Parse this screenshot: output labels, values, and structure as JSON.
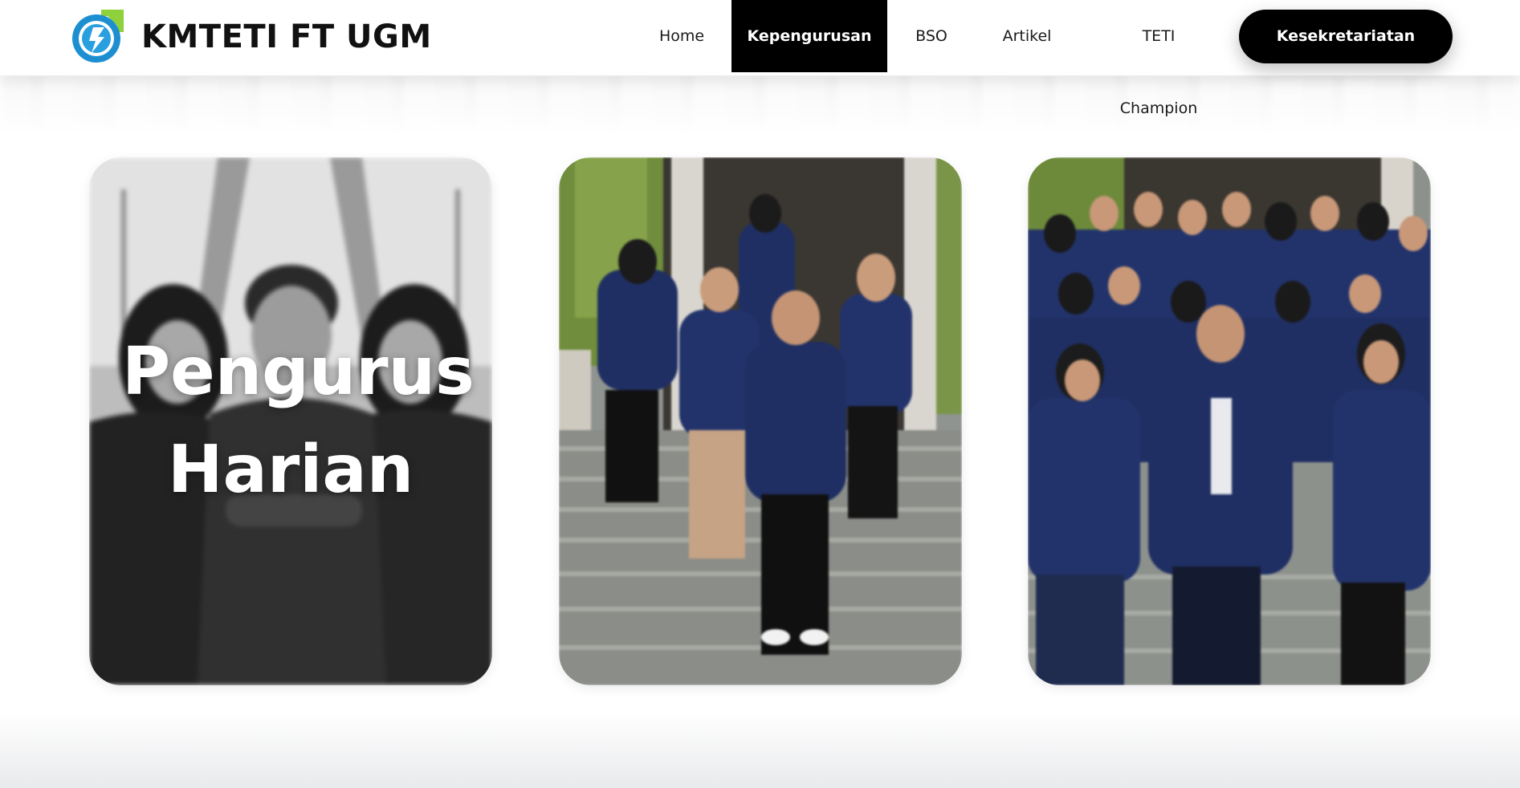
{
  "header": {
    "brand": "KMTETI FT UGM",
    "logo_icon": "kmteti-logo-icon",
    "nav": [
      {
        "label": "Home",
        "active": false
      },
      {
        "label": "Kepengurusan",
        "active": true
      },
      {
        "label": "BSO",
        "active": false
      },
      {
        "label": "Artikel",
        "active": false
      },
      {
        "label": "TETI Champion",
        "active": false
      }
    ],
    "cta_label": "Kesekretariatan"
  },
  "cards": [
    {
      "title": "Pengurus Harian",
      "style": "grayscale"
    },
    {
      "title": "",
      "style": "color"
    },
    {
      "title": "",
      "style": "color"
    }
  ],
  "colors": {
    "accent": "#000000",
    "jacket_navy": "#1f2f63",
    "logo_blue": "#1d8fd1",
    "logo_green": "#8fd13a"
  }
}
